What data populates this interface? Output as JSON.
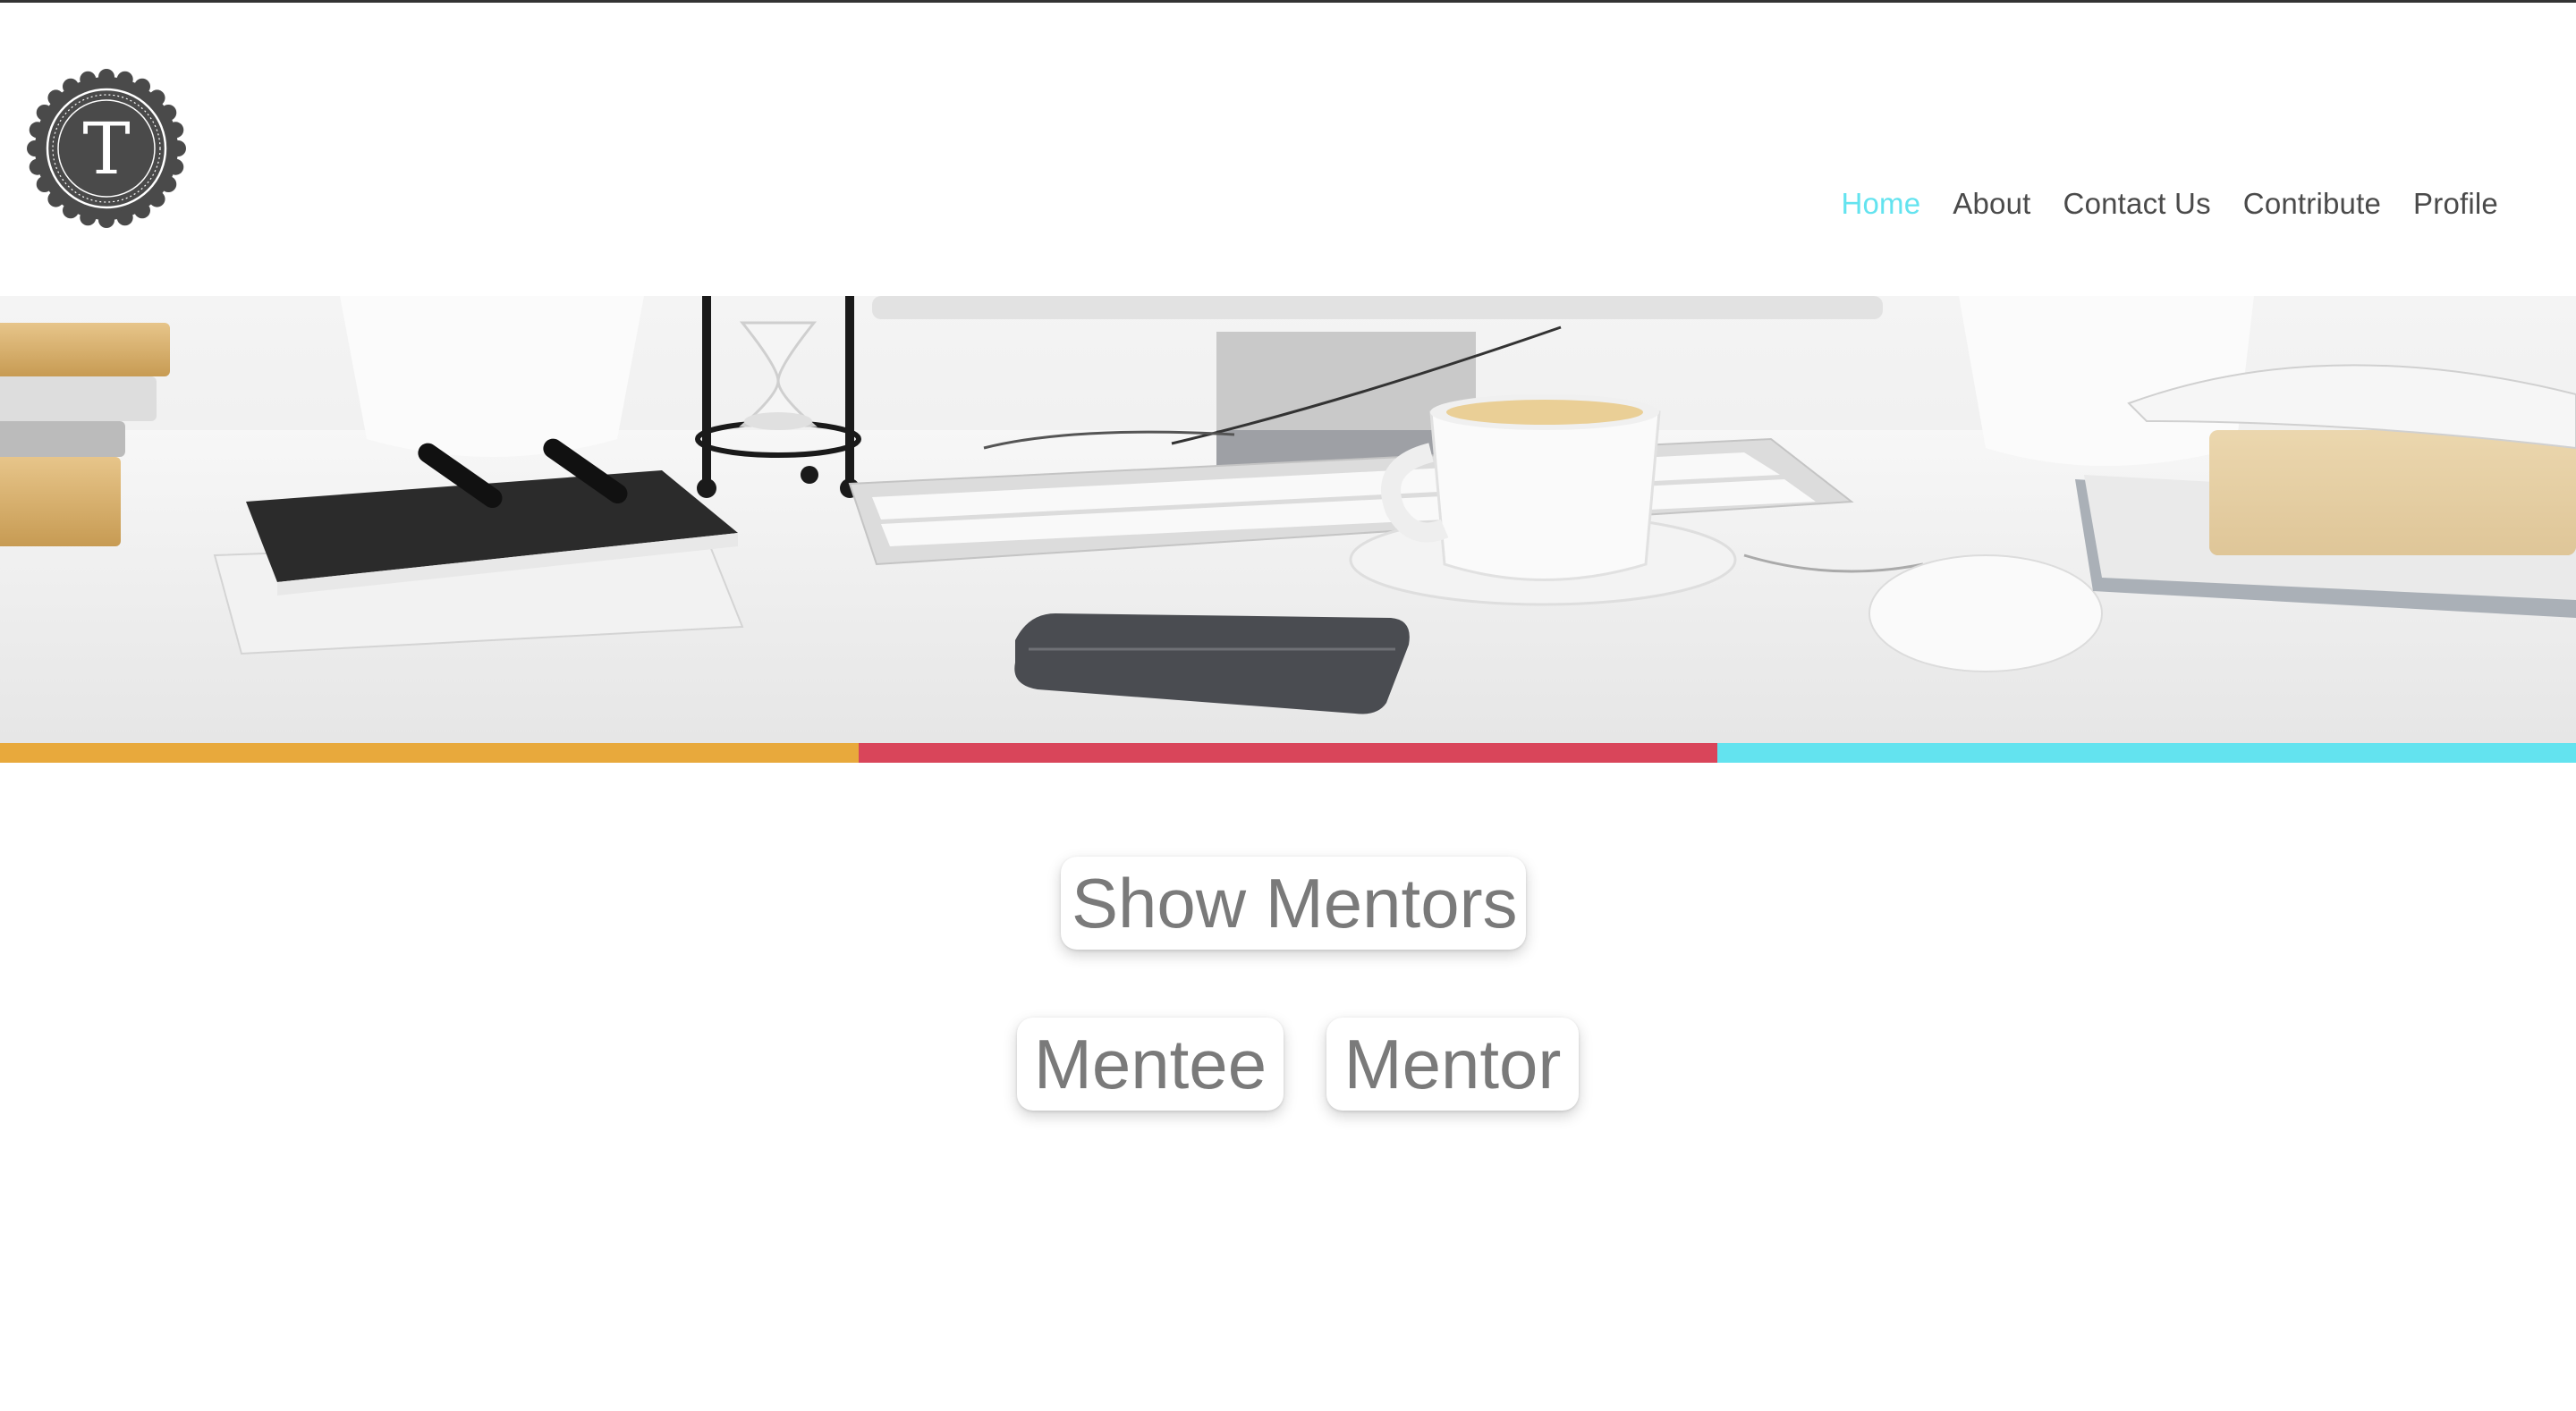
{
  "logo": {
    "letter": "T",
    "icon": "logo-emblem"
  },
  "nav": {
    "items": [
      {
        "label": "Home",
        "active": true
      },
      {
        "label": "About",
        "active": false
      },
      {
        "label": "Contact Us",
        "active": false
      },
      {
        "label": "Contribute",
        "active": false
      },
      {
        "label": "Profile",
        "active": false
      }
    ],
    "active_color": "#63e3ef",
    "text_color": "#4a4a4a"
  },
  "hero": {
    "image": "desk-with-keyboard-coffee-cup-books-phone"
  },
  "stripes": {
    "colors": [
      "#e8a93c",
      "#d9455a",
      "#63e3ef"
    ]
  },
  "actions": {
    "show_mentors": "Show Mentors",
    "mentee": "Mentee",
    "mentor": "Mentor"
  }
}
